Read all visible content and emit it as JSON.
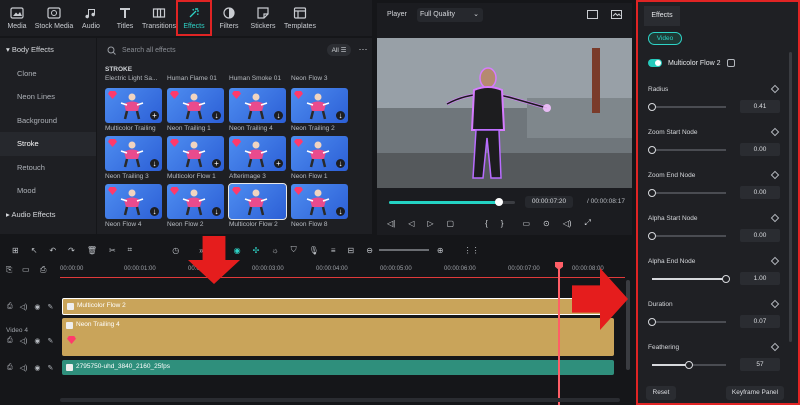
{
  "toolbar": {
    "items": [
      {
        "label": "Media",
        "icon": "media-icon"
      },
      {
        "label": "Stock Media",
        "icon": "stock-media-icon"
      },
      {
        "label": "Audio",
        "icon": "audio-icon"
      },
      {
        "label": "Titles",
        "icon": "titles-icon"
      },
      {
        "label": "Transitions",
        "icon": "transitions-icon"
      },
      {
        "label": "Effects",
        "icon": "effects-icon",
        "active": true
      },
      {
        "label": "Filters",
        "icon": "filters-icon"
      },
      {
        "label": "Stickers",
        "icon": "stickers-icon"
      },
      {
        "label": "Templates",
        "icon": "templates-icon"
      }
    ]
  },
  "leftnav": {
    "header": "Body Effects",
    "items": [
      "Clone",
      "Neon Lines",
      "Background",
      "Stroke",
      "Retouch",
      "Mood"
    ],
    "selected": "Stroke",
    "footer": "Audio Effects"
  },
  "grid": {
    "search_placeholder": "Search all effects",
    "filter": "All",
    "section": "STROKE",
    "top_labels": [
      "Electric Light Sa...",
      "Human Flame 01",
      "Human Smoke 01",
      "Neon Flow 3"
    ],
    "cells": [
      {
        "label": "Multicolor Trailing",
        "badge": "plus"
      },
      {
        "label": "Neon Trailing 1",
        "badge": "download"
      },
      {
        "label": "Neon Trailing 4",
        "badge": "download"
      },
      {
        "label": "Neon Trailing 2",
        "badge": "download"
      },
      {
        "label": "Neon Trailing 3",
        "badge": "download"
      },
      {
        "label": "Multicolor Flow 1",
        "badge": "plus"
      },
      {
        "label": "Afterimage 3",
        "badge": "plus"
      },
      {
        "label": "Neon Flow 1",
        "badge": "download"
      },
      {
        "label": "Neon Flow 4",
        "badge": "download"
      },
      {
        "label": "Neon Flow 2",
        "badge": "download"
      },
      {
        "label": "Multicolor Flow 2",
        "badge": "none",
        "selected": true
      },
      {
        "label": "Neon Flow 8",
        "badge": "download"
      }
    ]
  },
  "player": {
    "label": "Player",
    "quality": "Full Quality",
    "current_time": "00:00:07:20",
    "total_time": "/ 00:00:08:17",
    "progress": 0.87
  },
  "effects_panel": {
    "tab": "Effects",
    "subtab": "Video",
    "effect_name": "Multicolor Flow 2",
    "params": [
      {
        "name": "Radius",
        "value": "0.41",
        "fraction": 0.0
      },
      {
        "name": "Zoom Start Node",
        "value": "0.00",
        "fraction": 0.0
      },
      {
        "name": "Zoom End Node",
        "value": "0.00",
        "fraction": 0.0
      },
      {
        "name": "Alpha Start Node",
        "value": "0.00",
        "fraction": 0.0
      },
      {
        "name": "Alpha End Node",
        "value": "1.00",
        "fraction": 1.0
      },
      {
        "name": "Duration",
        "value": "0.07",
        "fraction": 0.0
      },
      {
        "name": "Feathering",
        "value": "57",
        "fraction": 0.5
      }
    ],
    "reset_label": "Reset",
    "keyframe_label": "Keyframe Panel"
  },
  "timeline": {
    "ticks": [
      "00:00:00",
      "00:00:01:00",
      "00:00:02:00",
      "00:00:03:00",
      "00:00:04:00",
      "00:00:05:00",
      "00:00:06:00",
      "00:00:07:00",
      "00:00:08:00"
    ],
    "track_label": "Video 4",
    "clips": {
      "top": "Multicolor Flow 2",
      "middle": "Neon Trailing 4",
      "video": "2795750-uhd_3840_2160_25fps"
    }
  }
}
